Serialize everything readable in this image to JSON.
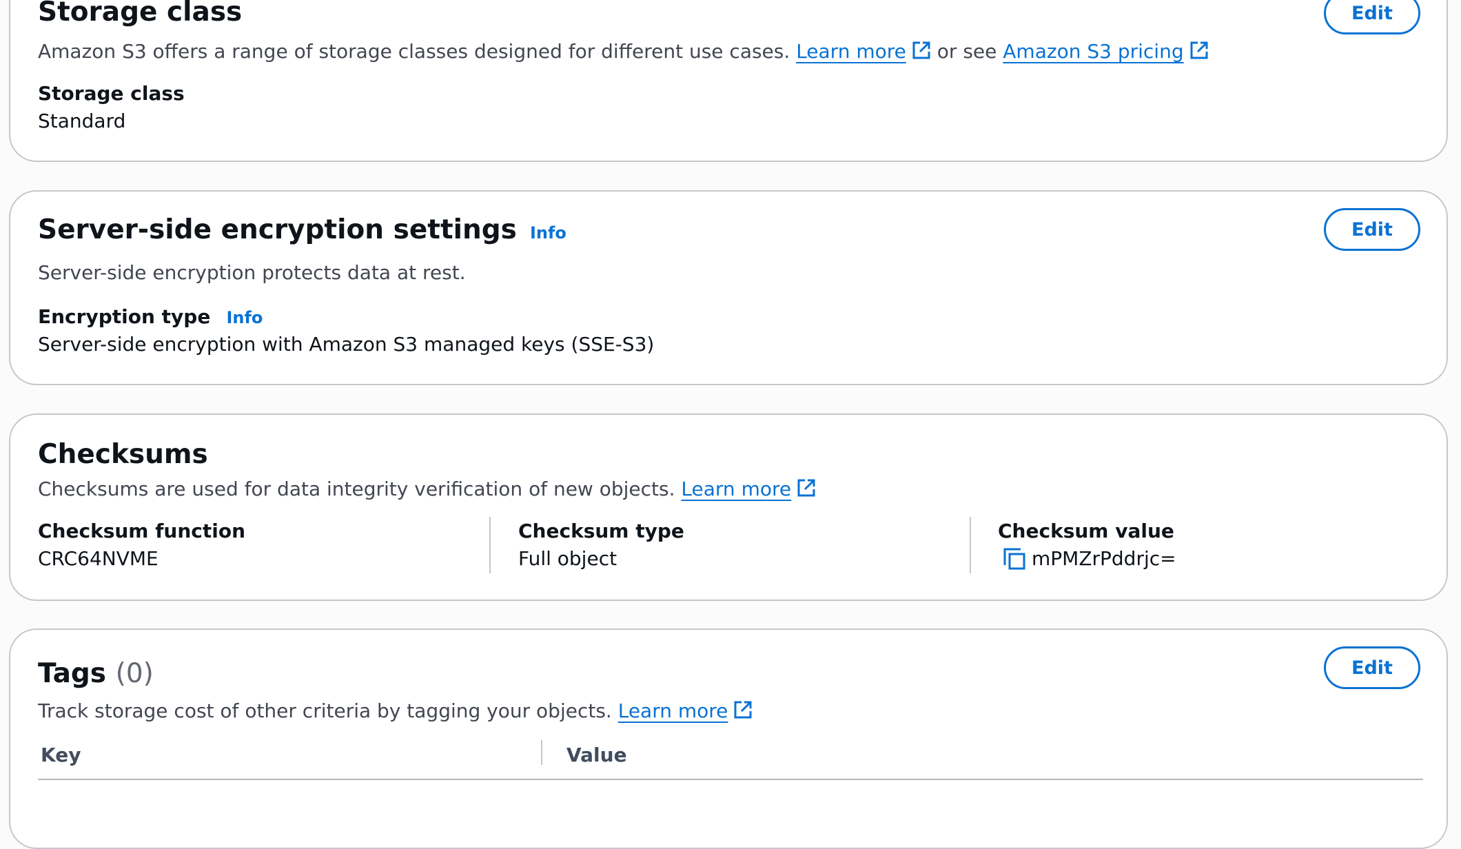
{
  "storage_class": {
    "title": "Storage class",
    "edit_label": "Edit",
    "desc_prefix": "Amazon S3 offers a range of storage classes designed for different use cases.",
    "learn_more": "Learn more",
    "or_see": "or see",
    "pricing_link": "Amazon S3 pricing",
    "field_label": "Storage class",
    "field_value": "Standard"
  },
  "encryption": {
    "title": "Server-side encryption settings",
    "info": "Info",
    "edit_label": "Edit",
    "description": "Server-side encryption protects data at rest.",
    "field_label": "Encryption type",
    "field_info": "Info",
    "field_value": "Server-side encryption with Amazon S3 managed keys (SSE-S3)"
  },
  "checksums": {
    "title": "Checksums",
    "desc_prefix": "Checksums are used for data integrity verification of new objects.",
    "learn_more": "Learn more",
    "columns": [
      {
        "label": "Checksum function",
        "value": "CRC64NVME"
      },
      {
        "label": "Checksum type",
        "value": "Full object"
      },
      {
        "label": "Checksum value",
        "value": "mPMZrPddrjc="
      }
    ]
  },
  "tags": {
    "title": "Tags",
    "count": "(0)",
    "edit_label": "Edit",
    "desc_prefix": "Track storage cost of other criteria by tagging your objects.",
    "learn_more": "Learn more",
    "columns": [
      "Key",
      "Value"
    ]
  },
  "icons": {
    "external_link": "external-link-icon",
    "copy": "copy-icon"
  },
  "colors": {
    "link": "#0972d3",
    "border": "#c6c6cd",
    "text": "#0f141a",
    "muted": "#424650"
  }
}
